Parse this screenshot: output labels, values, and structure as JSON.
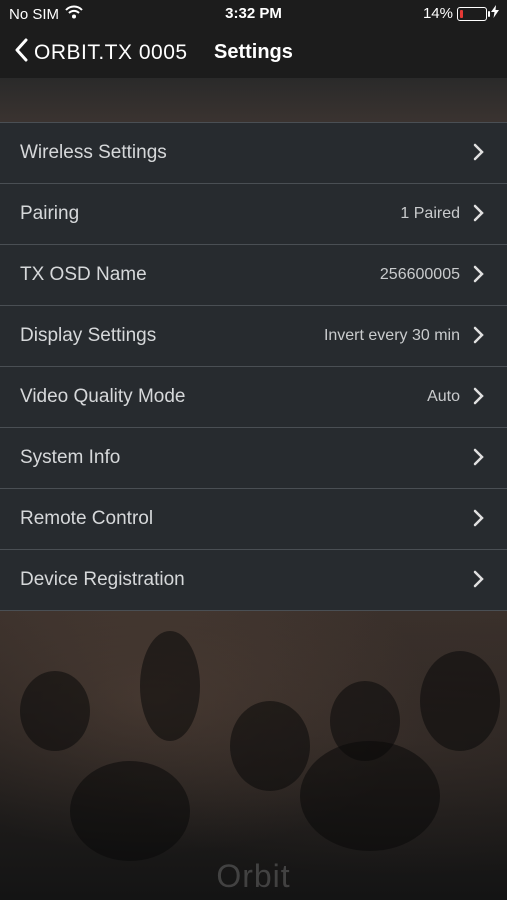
{
  "status_bar": {
    "carrier": "No SIM",
    "time": "3:32 PM",
    "battery": "14%",
    "battery_level": 0.14
  },
  "nav": {
    "back_label": "ORBIT.TX 0005",
    "title": "Settings"
  },
  "settings": [
    {
      "label": "Wireless Settings",
      "value": ""
    },
    {
      "label": "Pairing",
      "value": "1 Paired"
    },
    {
      "label": "TX OSD Name",
      "value": "256600005"
    },
    {
      "label": "Display Settings",
      "value": "Invert every 30 min"
    },
    {
      "label": "Video Quality Mode",
      "value": "Auto"
    },
    {
      "label": "System Info",
      "value": ""
    },
    {
      "label": "Remote Control",
      "value": ""
    },
    {
      "label": "Device Registration",
      "value": ""
    }
  ],
  "brand_watermark": "Orbit",
  "colors": {
    "row_background": "#272b2f",
    "row_divider": "#4a4f54",
    "battery_low": "#e53935"
  }
}
